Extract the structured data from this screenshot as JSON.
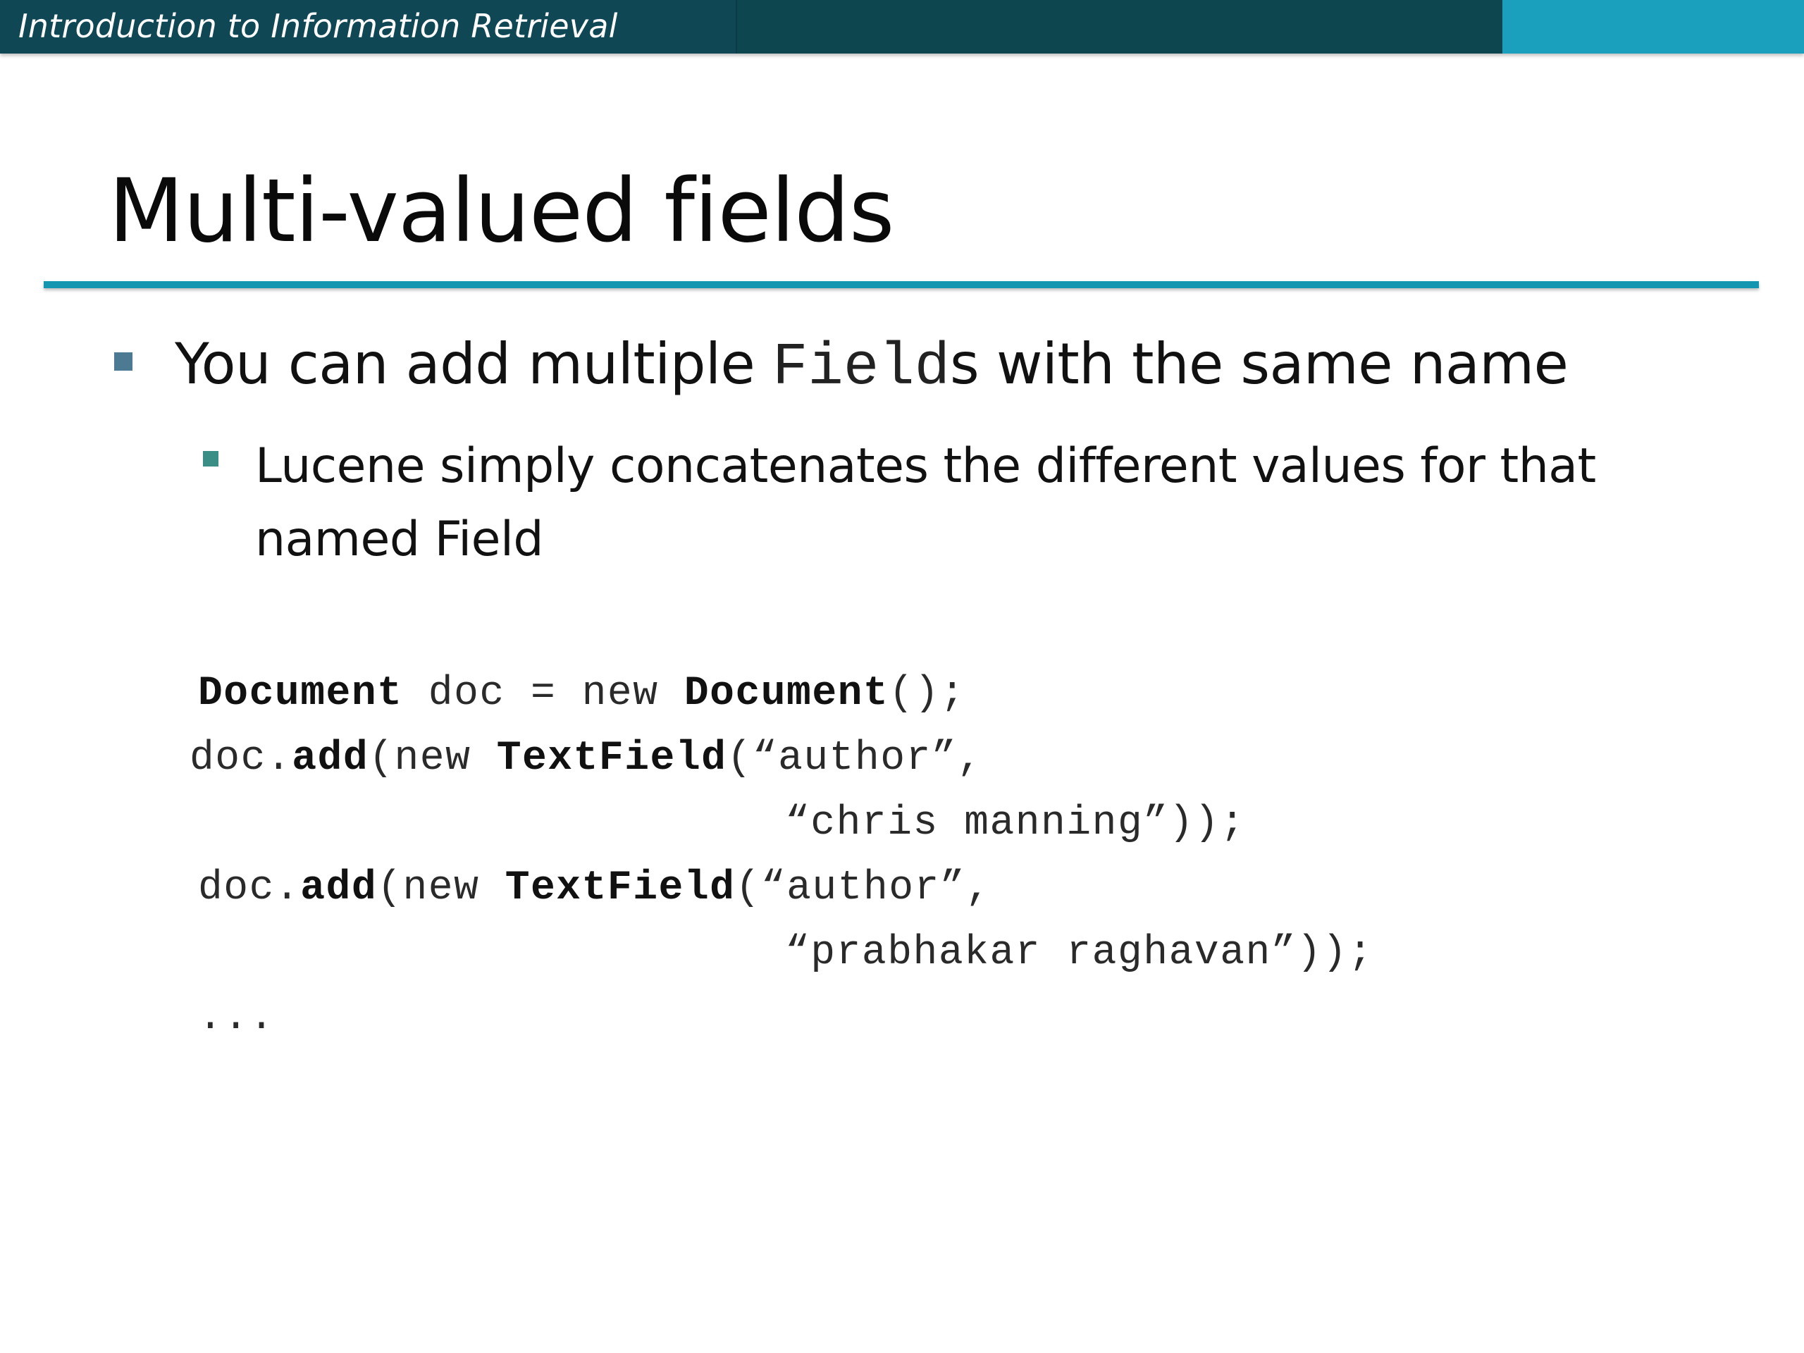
{
  "header": {
    "title": "Introduction to Information Retrieval"
  },
  "slide": {
    "title": "Multi-valued fields",
    "bullet1": {
      "pre": "You can add multiple ",
      "code": "Field",
      "post": "s with the same name"
    },
    "bullet2": "Lucene simply concatenates the different values for that named Field"
  },
  "code": {
    "line1": {
      "kw1": "Document",
      "mid": " doc = new ",
      "kw2": "Document",
      "end": "();"
    },
    "line2": {
      "pre": "doc.",
      "kw1": "add",
      "mid": "(new ",
      "kw2": "TextField",
      "end": "(“author”,"
    },
    "line3": "“chris manning”));",
    "line4": {
      "pre": "doc.",
      "kw1": "add",
      "mid": "(new ",
      "kw2": "TextField",
      "end": "(“author”,"
    },
    "line5": "“prabhakar raghavan”));",
    "line6": "..."
  },
  "colors": {
    "header_dark": "#0f4854",
    "header_accent": "#1aa0bd",
    "rule": "#1596b0",
    "bullet1": "#4d7a93",
    "bullet2": "#3a8e86"
  }
}
